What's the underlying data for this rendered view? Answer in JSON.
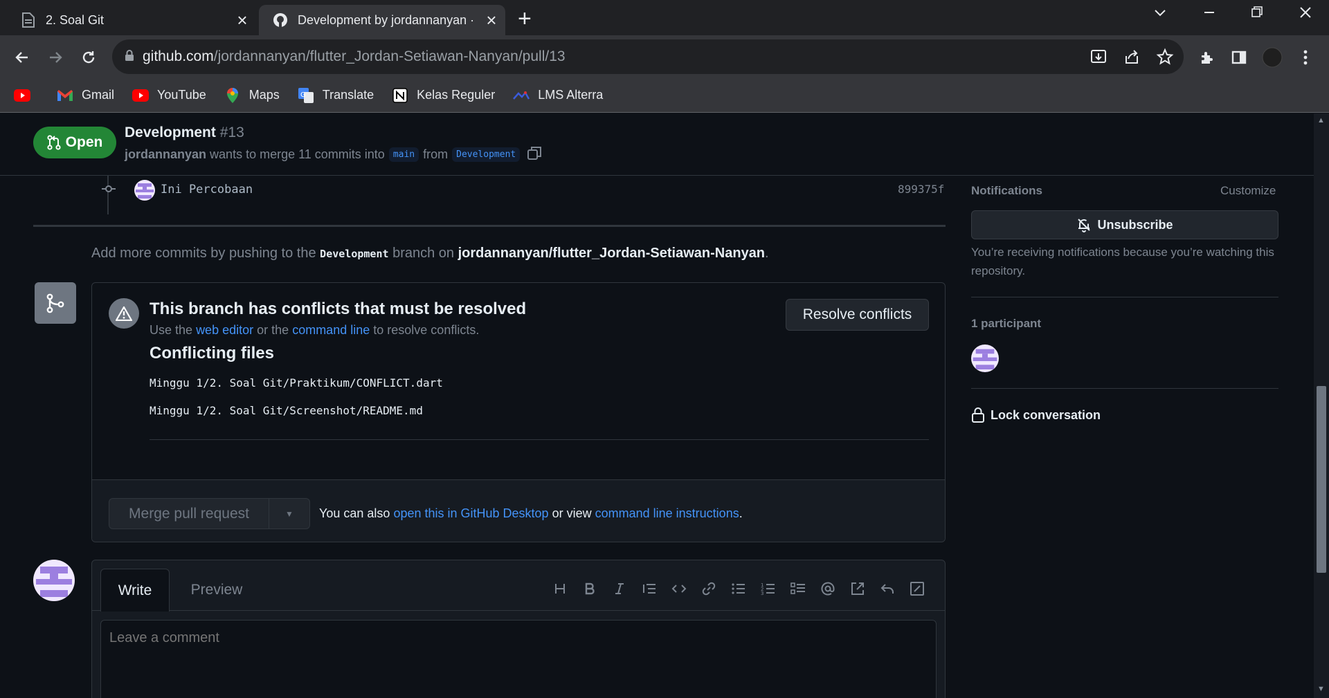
{
  "browser": {
    "tabs": [
      {
        "title": "2. Soal Git"
      },
      {
        "title": "Development by jordannanyan · "
      }
    ],
    "url_host": "github.com",
    "url_path": "/jordannanyan/flutter_Jordan-Setiawan-Nanyan/pull/13",
    "bookmarks": [
      {
        "label": ""
      },
      {
        "label": "Gmail"
      },
      {
        "label": "YouTube"
      },
      {
        "label": "Maps"
      },
      {
        "label": "Translate"
      },
      {
        "label": "Kelas Reguler"
      },
      {
        "label": "LMS Alterra"
      }
    ]
  },
  "pr": {
    "state": "Open",
    "title": "Development",
    "number": "#13",
    "author": "jordannanyan",
    "meta_text": "wants to merge 11 commits into",
    "base": "main",
    "from_text": "from",
    "head": "Development"
  },
  "commit": {
    "message": "Ini Percobaan",
    "sha": "899375f"
  },
  "add_commits": {
    "prefix": "Add more commits by pushing to the",
    "branch": "Development",
    "middle": "branch on",
    "repo": "jordannanyan/flutter_Jordan-Setiawan-Nanyan",
    "suffix": "."
  },
  "mergebox": {
    "title": "This branch has conflicts that must be resolved",
    "sub_prefix": "Use the",
    "web_editor": "web editor",
    "sub_or": "or the",
    "command_line": "command line",
    "sub_suffix": "to resolve conflicts.",
    "files_heading": "Conflicting files",
    "files": [
      "Minggu 1/2. Soal Git/Praktikum/CONFLICT.dart",
      "Minggu 1/2. Soal Git/Screenshot/README.md"
    ],
    "resolve_label": "Resolve conflicts",
    "merge_label": "Merge pull request",
    "foot_prefix": "You can also",
    "foot_desktop": "open this in GitHub Desktop",
    "foot_or": "or view",
    "foot_cli": "command line instructions",
    "foot_suffix": "."
  },
  "comment": {
    "tab_write": "Write",
    "tab_preview": "Preview",
    "placeholder": "Leave a comment"
  },
  "sidebar": {
    "notifications_heading": "Notifications",
    "customize": "Customize",
    "unsubscribe": "Unsubscribe",
    "note": "You’re receiving notifications because you’re watching this repository.",
    "participants_heading": "1 participant",
    "lock": "Lock conversation"
  },
  "colors": {
    "open_badge": "#238636",
    "link": "#4493f8",
    "page_bg": "#0d1117"
  }
}
